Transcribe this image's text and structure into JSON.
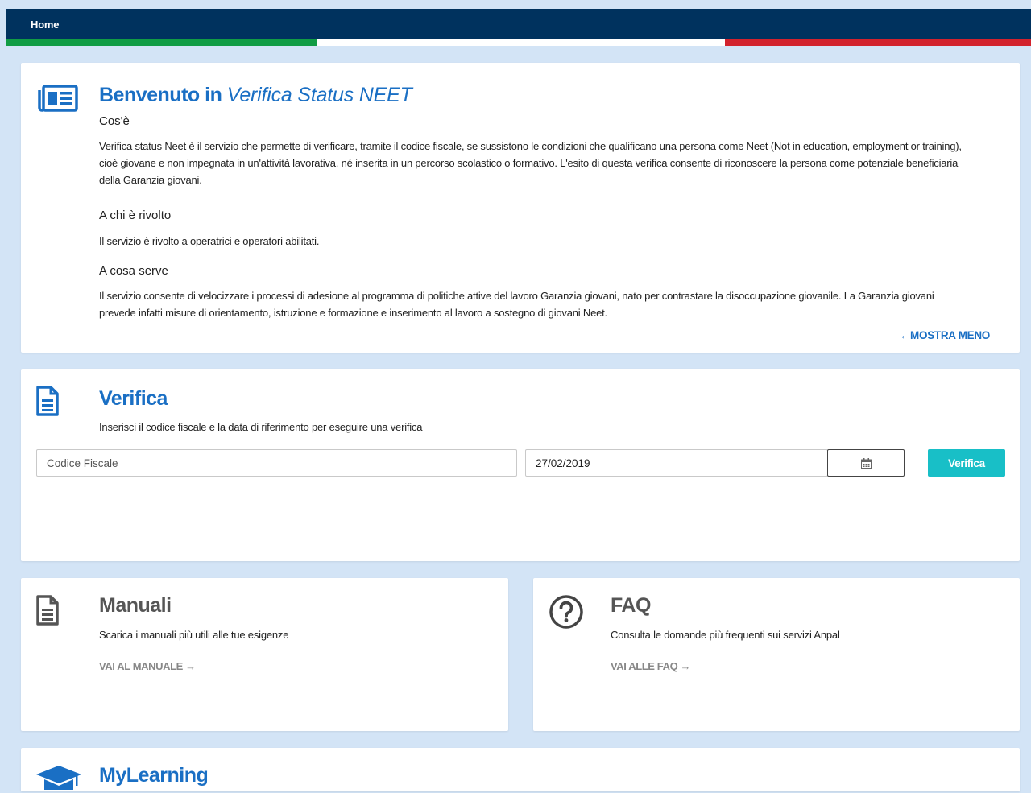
{
  "nav": {
    "home_label": "Home"
  },
  "welcome": {
    "title_prefix": "Benvenuto in",
    "title_service": "Verifica Status NEET",
    "what_heading": "Cos'è",
    "what_text": "Verifica status Neet è il servizio che permette di verificare, tramite il codice fiscale, se sussistono le condizioni che qualificano una persona come Neet (Not in education, employment or training), cioè giovane e non impegnata in un'attività lavorativa, né inserita in un percorso scolastico o formativo. L'esito di questa verifica consente di riconoscere la persona come potenziale beneficiaria della Garanzia giovani.",
    "who_heading": "A chi è rivolto",
    "who_text": "Il servizio è rivolto a operatrici e operatori abilitati.",
    "purpose_heading": "A cosa serve",
    "purpose_text": "Il servizio consente di velocizzare i processi di adesione al programma di politiche attive del lavoro Garanzia giovani, nato per contrastare la disoccupazione giovanile. La Garanzia giovani prevede infatti misure di orientamento, istruzione e formazione e inserimento al lavoro a sostegno di giovani Neet.",
    "show_less_label": "MOSTRA MENO",
    "show_less_arrow": "←"
  },
  "verify": {
    "title": "Verifica",
    "description": "Inserisci il codice fiscale e la data di riferimento per eseguire una verifica",
    "fiscal_code_placeholder": "Codice Fiscale",
    "fiscal_code_value": "",
    "date_value": "27/02/2019",
    "button_label": "Verifica"
  },
  "manuals": {
    "title": "Manuali",
    "description": "Scarica i manuali più utili alle tue esigenze",
    "link_label": "VAI AL MANUALE",
    "link_arrow": "→"
  },
  "faq": {
    "title": "FAQ",
    "description": "Consulta le domande più frequenti sui servizi Anpal",
    "link_label": "VAI ALLE FAQ",
    "link_arrow": "→"
  },
  "mylearning": {
    "title": "MyLearning"
  },
  "colors": {
    "navy": "#00325e",
    "accent_blue": "#1a6fc4",
    "teal": "#18bfc7",
    "page_bg": "#d3e4f6",
    "flag_green": "#119c44",
    "flag_red": "#d2222d"
  },
  "icons": {
    "welcome": "newspaper-icon",
    "verify": "document-icon",
    "manuals": "document-icon",
    "faq": "question-circle-icon",
    "calendar": "calendar-icon",
    "mylearning": "graduation-cap-icon"
  }
}
